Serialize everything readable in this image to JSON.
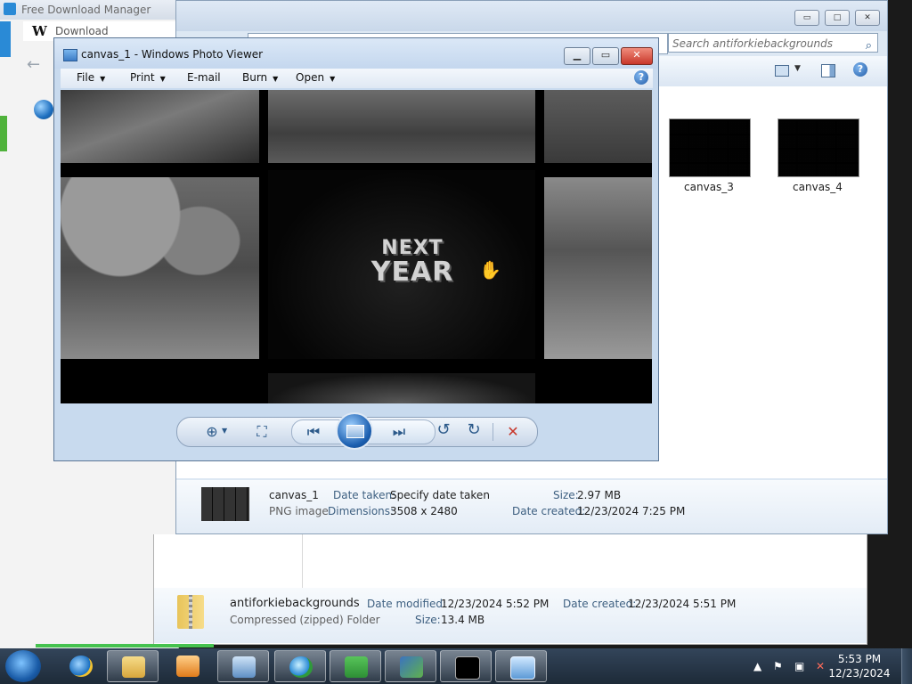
{
  "background": {
    "fdm_title": "Free Download Manager",
    "aero_site_title": "Download AeroRainbow",
    "aero_logo_letter": "W"
  },
  "explorer": {
    "search_placeholder": "Search antiforkiebackgrounds",
    "win_minimize": "▭",
    "win_maximize": "□",
    "win_close": "✕",
    "thumbnails": [
      {
        "label": "canvas_3"
      },
      {
        "label": "canvas_4"
      }
    ],
    "details": {
      "name": "canvas_1",
      "type": "PNG image",
      "date_taken_label": "Date taken:",
      "date_taken_value": "Specify date taken",
      "dimensions_label": "Dimensions:",
      "dimensions_value": "3508 x 2480",
      "size_label": "Size:",
      "size_value": "2.97 MB",
      "date_created_label": "Date created:",
      "date_created_value": "12/23/2024 7:25 PM"
    }
  },
  "explorer2": {
    "name": "antiforkiebackgrounds",
    "type": "Compressed (zipped) Folder",
    "date_modified_label": "Date modified:",
    "date_modified_value": "12/23/2024 5:52 PM",
    "date_created_label": "Date created:",
    "date_created_value": "12/23/2024 5:51 PM",
    "size_label": "Size:",
    "size_value": "13.4 MB"
  },
  "viewer": {
    "title": "canvas_1 - Windows Photo Viewer",
    "menu": [
      {
        "label": "File",
        "caret": true
      },
      {
        "label": "Print",
        "caret": true
      },
      {
        "label": "E-mail",
        "caret": false
      },
      {
        "label": "Burn",
        "caret": true
      },
      {
        "label": "Open",
        "caret": true
      }
    ],
    "help": "?",
    "image_text_line1": "NEXT",
    "image_text_line2": "YEAR",
    "controls": {
      "zoom": "⊕",
      "actual_size": "⛶",
      "previous": "⏮",
      "next": "⏭",
      "rotate_ccw": "↺",
      "rotate_cw": "↻",
      "delete": "✕"
    }
  },
  "taskbar": {
    "clock_time": "5:53 PM",
    "clock_date": "12/23/2024"
  },
  "colors": {
    "accent_blue": "#2c5a8a",
    "delete_red": "#c8372a",
    "taskbar": "#26364a"
  }
}
